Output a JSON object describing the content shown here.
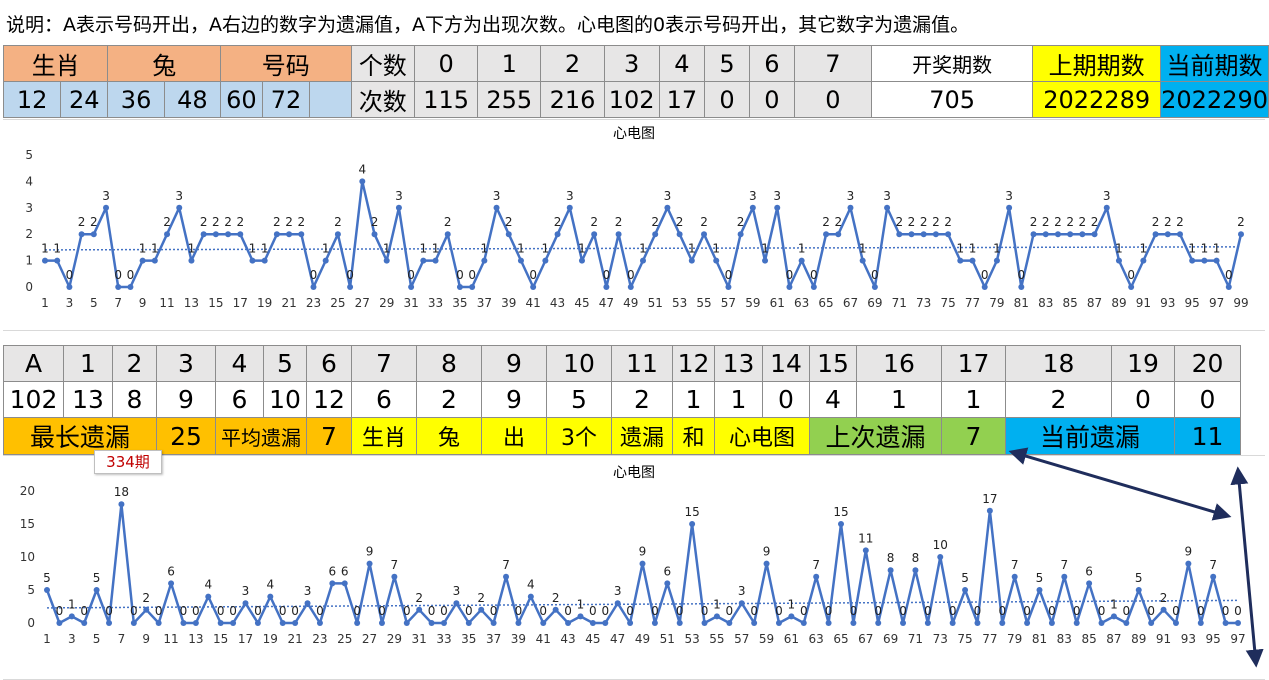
{
  "note": "说明：A表示号码开出，A右边的数字为遗漏值，A下方为出现次数。心电图的0表示号码开出，其它数字为遗漏值。",
  "top_table": {
    "zodiac_label": "生肖",
    "zodiac_value": "兔",
    "numbers_label": "号码",
    "numbers": [
      "12",
      "24",
      "36",
      "48",
      "60",
      "72",
      ""
    ],
    "count_label": "个数",
    "times_label": "次数",
    "digits": [
      "0",
      "1",
      "2",
      "3",
      "4",
      "5",
      "6",
      "7"
    ],
    "times": [
      "115",
      "255",
      "216",
      "102",
      "17",
      "0",
      "0",
      "0"
    ],
    "draws_label": "开奖期数",
    "draws_value": "705",
    "prev_label": "上期期数",
    "prev_value": "2022289",
    "cur_label": "当前期数",
    "cur_value": "2022290"
  },
  "mid_table": {
    "headers": [
      "A",
      "1",
      "2",
      "3",
      "4",
      "5",
      "6",
      "7",
      "8",
      "9",
      "10",
      "11",
      "12",
      "13",
      "14",
      "15",
      "16",
      "17",
      "18",
      "19",
      "20"
    ],
    "values": [
      "102",
      "13",
      "8",
      "9",
      "6",
      "10",
      "12",
      "6",
      "2",
      "9",
      "5",
      "2",
      "1",
      "1",
      "0",
      "4",
      "1",
      "1",
      "2",
      "0",
      "0"
    ],
    "max_miss_label": "最长遗漏",
    "max_miss_value": "25",
    "avg_miss_label": "平均遗漏",
    "avg_miss_value": "7",
    "desc": [
      "生肖",
      "兔",
      "出",
      "3个",
      "遗漏",
      "和",
      "心电图"
    ],
    "last_miss_label": "上次遗漏",
    "last_miss_value": "7",
    "cur_miss_label": "当前遗漏",
    "cur_miss_value": "11"
  },
  "callout": "334期",
  "colors": {
    "salmon": "#f4b183",
    "light_blue": "#bdd7ee",
    "grey": "#e7e6e6",
    "yellow": "#ffff00",
    "cyan": "#00b0f0",
    "orange": "#ffc000",
    "green": "#92d050",
    "line": "#4472c4",
    "arrow": "#1f2d5c"
  },
  "chart_data": [
    {
      "type": "line",
      "title": "心电图",
      "xlabel": "",
      "ylabel": "",
      "ylim": [
        0,
        5
      ],
      "yticks": [
        0,
        1,
        2,
        3,
        4,
        5
      ],
      "xtick_step": 2,
      "grid": false,
      "trendline": "dotted",
      "x": [
        1,
        2,
        3,
        4,
        5,
        6,
        7,
        8,
        9,
        10,
        11,
        12,
        13,
        14,
        15,
        16,
        17,
        18,
        19,
        20,
        21,
        22,
        23,
        24,
        25,
        26,
        27,
        28,
        29,
        30,
        31,
        32,
        33,
        34,
        35,
        36,
        37,
        38,
        39,
        40,
        41,
        42,
        43,
        44,
        45,
        46,
        47,
        48,
        49,
        50,
        51,
        52,
        53,
        54,
        55,
        56,
        57,
        58,
        59,
        60,
        61,
        62,
        63,
        64,
        65,
        66,
        67,
        68,
        69,
        70,
        71,
        72,
        73,
        74,
        75,
        76,
        77,
        78,
        79,
        80,
        81,
        82,
        83,
        84,
        85,
        86,
        87,
        88,
        89,
        90,
        91,
        92,
        93,
        94,
        95,
        96,
        97,
        98,
        99
      ],
      "values": [
        1,
        1,
        0,
        2,
        2,
        3,
        0,
        0,
        1,
        1,
        2,
        3,
        1,
        2,
        2,
        2,
        2,
        1,
        1,
        2,
        2,
        2,
        0,
        1,
        2,
        0,
        4,
        2,
        1,
        3,
        0,
        1,
        1,
        2,
        0,
        0,
        1,
        3,
        2,
        1,
        0,
        1,
        2,
        3,
        1,
        2,
        0,
        2,
        0,
        1,
        2,
        3,
        2,
        1,
        2,
        1,
        0,
        2,
        3,
        1,
        3,
        0,
        1,
        0,
        2,
        2,
        3,
        1,
        0,
        3,
        2,
        2,
        2,
        2,
        2,
        1,
        1,
        0,
        1,
        3,
        0,
        2,
        2,
        2,
        2,
        2,
        2,
        3,
        1,
        0,
        1,
        2,
        2,
        2,
        1,
        1,
        1,
        0,
        2
      ]
    },
    {
      "type": "line",
      "title": "心电图",
      "xlabel": "",
      "ylabel": "",
      "ylim": [
        0,
        20
      ],
      "yticks": [
        0,
        5,
        10,
        15,
        20
      ],
      "xtick_step": 2,
      "grid": false,
      "trendline": "dotted",
      "x": [
        1,
        2,
        3,
        4,
        5,
        6,
        7,
        8,
        9,
        10,
        11,
        12,
        13,
        14,
        15,
        16,
        17,
        18,
        19,
        20,
        21,
        22,
        23,
        24,
        25,
        26,
        27,
        28,
        29,
        30,
        31,
        32,
        33,
        34,
        35,
        36,
        37,
        38,
        39,
        40,
        41,
        42,
        43,
        44,
        45,
        46,
        47,
        48,
        49,
        50,
        51,
        52,
        53,
        54,
        55,
        56,
        57,
        58,
        59,
        60,
        61,
        62,
        63,
        64,
        65,
        66,
        67,
        68,
        69,
        70,
        71,
        72,
        73,
        74,
        75,
        76,
        77,
        78,
        79,
        80,
        81,
        82,
        83,
        84,
        85,
        86,
        87,
        88,
        89,
        90,
        91,
        92,
        93,
        94,
        95,
        96,
        97
      ],
      "values": [
        5,
        0,
        1,
        0,
        5,
        0,
        18,
        0,
        2,
        0,
        6,
        0,
        0,
        4,
        0,
        0,
        3,
        0,
        4,
        0,
        0,
        3,
        0,
        6,
        6,
        0,
        9,
        0,
        7,
        0,
        2,
        0,
        0,
        3,
        0,
        2,
        0,
        7,
        0,
        4,
        0,
        2,
        0,
        1,
        0,
        0,
        3,
        0,
        9,
        0,
        6,
        0,
        15,
        0,
        1,
        0,
        3,
        0,
        9,
        0,
        1,
        0,
        7,
        0,
        15,
        0,
        11,
        0,
        8,
        0,
        8,
        0,
        10,
        0,
        5,
        0,
        17,
        0,
        7,
        0,
        5,
        0,
        7,
        0,
        6,
        0,
        1,
        0,
        5,
        0,
        2,
        0,
        9,
        0,
        7,
        0,
        0
      ]
    }
  ]
}
